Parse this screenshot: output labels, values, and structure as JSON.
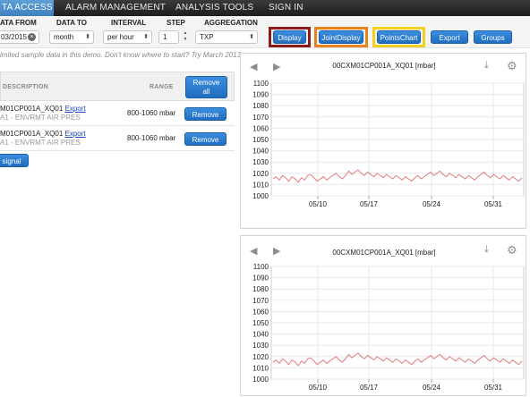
{
  "nav": {
    "tabs": [
      {
        "label": "TA ACCESS",
        "active": true
      },
      {
        "label": "ALARM MANAGEMENT",
        "active": false
      },
      {
        "label": "ANALYSIS TOOLS",
        "active": false
      },
      {
        "label": "SIGN IN",
        "active": false
      }
    ]
  },
  "filters": {
    "date_from": {
      "label": "ATA FROM",
      "value": "03/2015"
    },
    "date_to": {
      "label": "DATA TO",
      "value": "month"
    },
    "interval": {
      "label": "INTERVAL",
      "value": "per hour"
    },
    "step": {
      "label": "STEP",
      "value": "1"
    },
    "aggregation": {
      "label": "AGGREGATION",
      "value": "TXP"
    }
  },
  "buttons": {
    "display": "Display",
    "joint_display": "JointDisplay",
    "points_chart": "PointsChart",
    "export": "Export",
    "groups": "Groups"
  },
  "highlight_colors": {
    "display": "#8b1a1a",
    "joint_display": "#e8821e",
    "points_chart": "#f0d020"
  },
  "hint": "imited sample data in this demo. Don't know where to start? Try March 2013 ...",
  "signals_table": {
    "col_description": "DESCRIPTION",
    "col_range": "RANGE",
    "remove_all_line1": "Remove",
    "remove_all_line2": "all",
    "rows": [
      {
        "name": "M01CP001A_XQ01",
        "export_label": "Export",
        "desc": "A1 - ENVRMT AIR PRES",
        "range": "800-1060 mbar",
        "remove": "Remove"
      },
      {
        "name": "M01CP001A_XQ01",
        "export_label": "Export",
        "desc": "A1 - ENVRMT AIR PRES",
        "range": "800-1060 mbar",
        "remove": "Remove"
      }
    ],
    "add_signal": "signal"
  },
  "charts": [
    {
      "title": "00CXM01CP001A_XQ01 [mbar]"
    },
    {
      "title": "00CXM01CP001A_XQ01 [mbar]"
    }
  ],
  "chart_data": [
    {
      "type": "line",
      "title": "00CXM01CP001A_XQ01 [mbar]",
      "y_ticks": [
        "1100",
        "1090",
        "1080",
        "1070",
        "1060",
        "1050",
        "1040",
        "1030",
        "1020",
        "1010",
        "1000"
      ],
      "ylim": [
        1000,
        1100
      ],
      "x_ticks": [
        "05/10",
        "05/17",
        "05/24",
        "05/31"
      ],
      "grid": true,
      "series": [
        {
          "color": "#e07070",
          "values": [
            1015,
            1017,
            1014,
            1018,
            1016,
            1013,
            1017,
            1015,
            1012,
            1016,
            1014,
            1018,
            1019,
            1016,
            1013,
            1015,
            1017,
            1014,
            1016,
            1018,
            1020,
            1017,
            1015,
            1018,
            1022,
            1019,
            1021,
            1023,
            1020,
            1018,
            1021,
            1019,
            1017,
            1020,
            1018,
            1016,
            1019,
            1017,
            1015,
            1018,
            1016,
            1014,
            1017,
            1015,
            1013,
            1016,
            1018,
            1015,
            1017,
            1019,
            1021,
            1018,
            1020,
            1022,
            1019,
            1017,
            1020,
            1018,
            1016,
            1019,
            1017,
            1015,
            1018,
            1016,
            1014,
            1017,
            1019,
            1021,
            1018,
            1016,
            1019,
            1017,
            1015,
            1018,
            1016,
            1014,
            1017,
            1015,
            1013,
            1016
          ]
        }
      ]
    },
    {
      "type": "line",
      "title": "00CXM01CP001A_XQ01 [mbar]",
      "y_ticks": [
        "1100",
        "1090",
        "1080",
        "1070",
        "1060",
        "1050",
        "1040",
        "1030",
        "1020",
        "1010",
        "1000"
      ],
      "ylim": [
        1000,
        1100
      ],
      "x_ticks": [
        "05/10",
        "05/17",
        "05/24",
        "05/31"
      ],
      "grid": true,
      "series": [
        {
          "color": "#e07070",
          "values": [
            1015,
            1017,
            1014,
            1018,
            1016,
            1013,
            1017,
            1015,
            1012,
            1016,
            1014,
            1018,
            1019,
            1016,
            1013,
            1015,
            1017,
            1014,
            1016,
            1018,
            1020,
            1017,
            1015,
            1018,
            1022,
            1019,
            1021,
            1023,
            1020,
            1018,
            1021,
            1019,
            1017,
            1020,
            1018,
            1016,
            1019,
            1017,
            1015,
            1018,
            1016,
            1014,
            1017,
            1015,
            1013,
            1016,
            1018,
            1015,
            1017,
            1019,
            1021,
            1018,
            1020,
            1022,
            1019,
            1017,
            1020,
            1018,
            1016,
            1019,
            1017,
            1015,
            1018,
            1016,
            1014,
            1017,
            1019,
            1021,
            1018,
            1016,
            1019,
            1017,
            1015,
            1018,
            1016,
            1014,
            1017,
            1015,
            1013,
            1016
          ]
        }
      ]
    }
  ]
}
